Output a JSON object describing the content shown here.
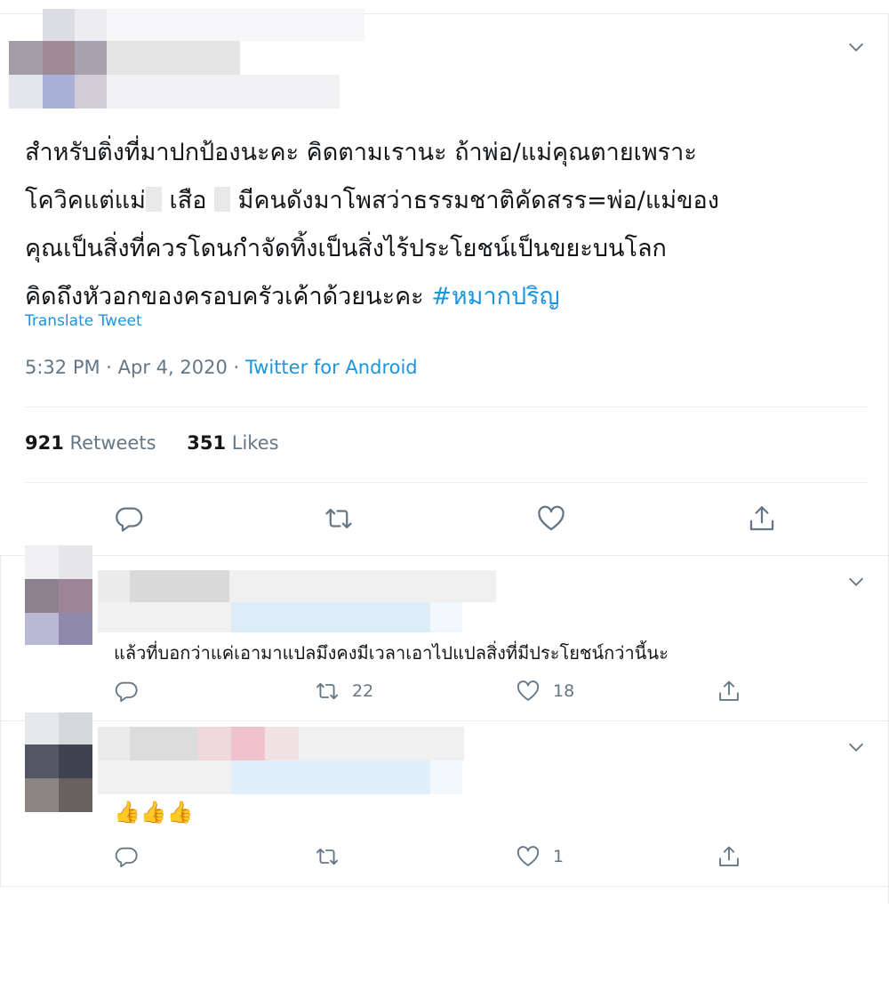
{
  "main_tweet": {
    "text_lines": [
      "สำหรับติ่งที่มาปกป้องนะคะ คิดตามเรานะ ถ้าพ่อ/แม่คุณตายเพราะ",
      "โควิคแต่แม่",
      "เสือ",
      "มีคนดังมาโพสว่าธรรมชาติคัดสรร=พ่อ/แม่ของ",
      "คุณเป็นสิ่งที่ควรโดนกำจัดทิ้งเป็นสิ่งไร้ประโยชน์เป็นขยะบนโลก",
      "คิดถึงหัวอกของครอบครัวเค้าด้วยนะคะ "
    ],
    "hashtag": "#หมากปริญ",
    "translate_label": "Translate Tweet",
    "time": "5:32 PM · Apr 4, 2020 · ",
    "source": "Twitter for Android",
    "retweets_count": "921",
    "retweets_label": "Retweets",
    "likes_count": "351",
    "likes_label": "Likes"
  },
  "replies": [
    {
      "text": "แล้วที่บอกว่าแค่เอามาแปลมึงคงมีเวลาเอาไปแปลสิ่งที่มีประโยชน์กว่านี้นะ",
      "retweets": "22",
      "likes": "18"
    },
    {
      "text": "👍👍👍",
      "retweets": "",
      "likes": "1"
    }
  ],
  "icons": {
    "reply": "reply-icon",
    "retweet": "retweet-icon",
    "like": "heart-icon",
    "share": "share-icon",
    "menu": "chevron-down-icon"
  },
  "colors": {
    "accent": "#1b95e0",
    "muted": "#657786",
    "text": "#14171a",
    "border": "#e6ecf0"
  }
}
